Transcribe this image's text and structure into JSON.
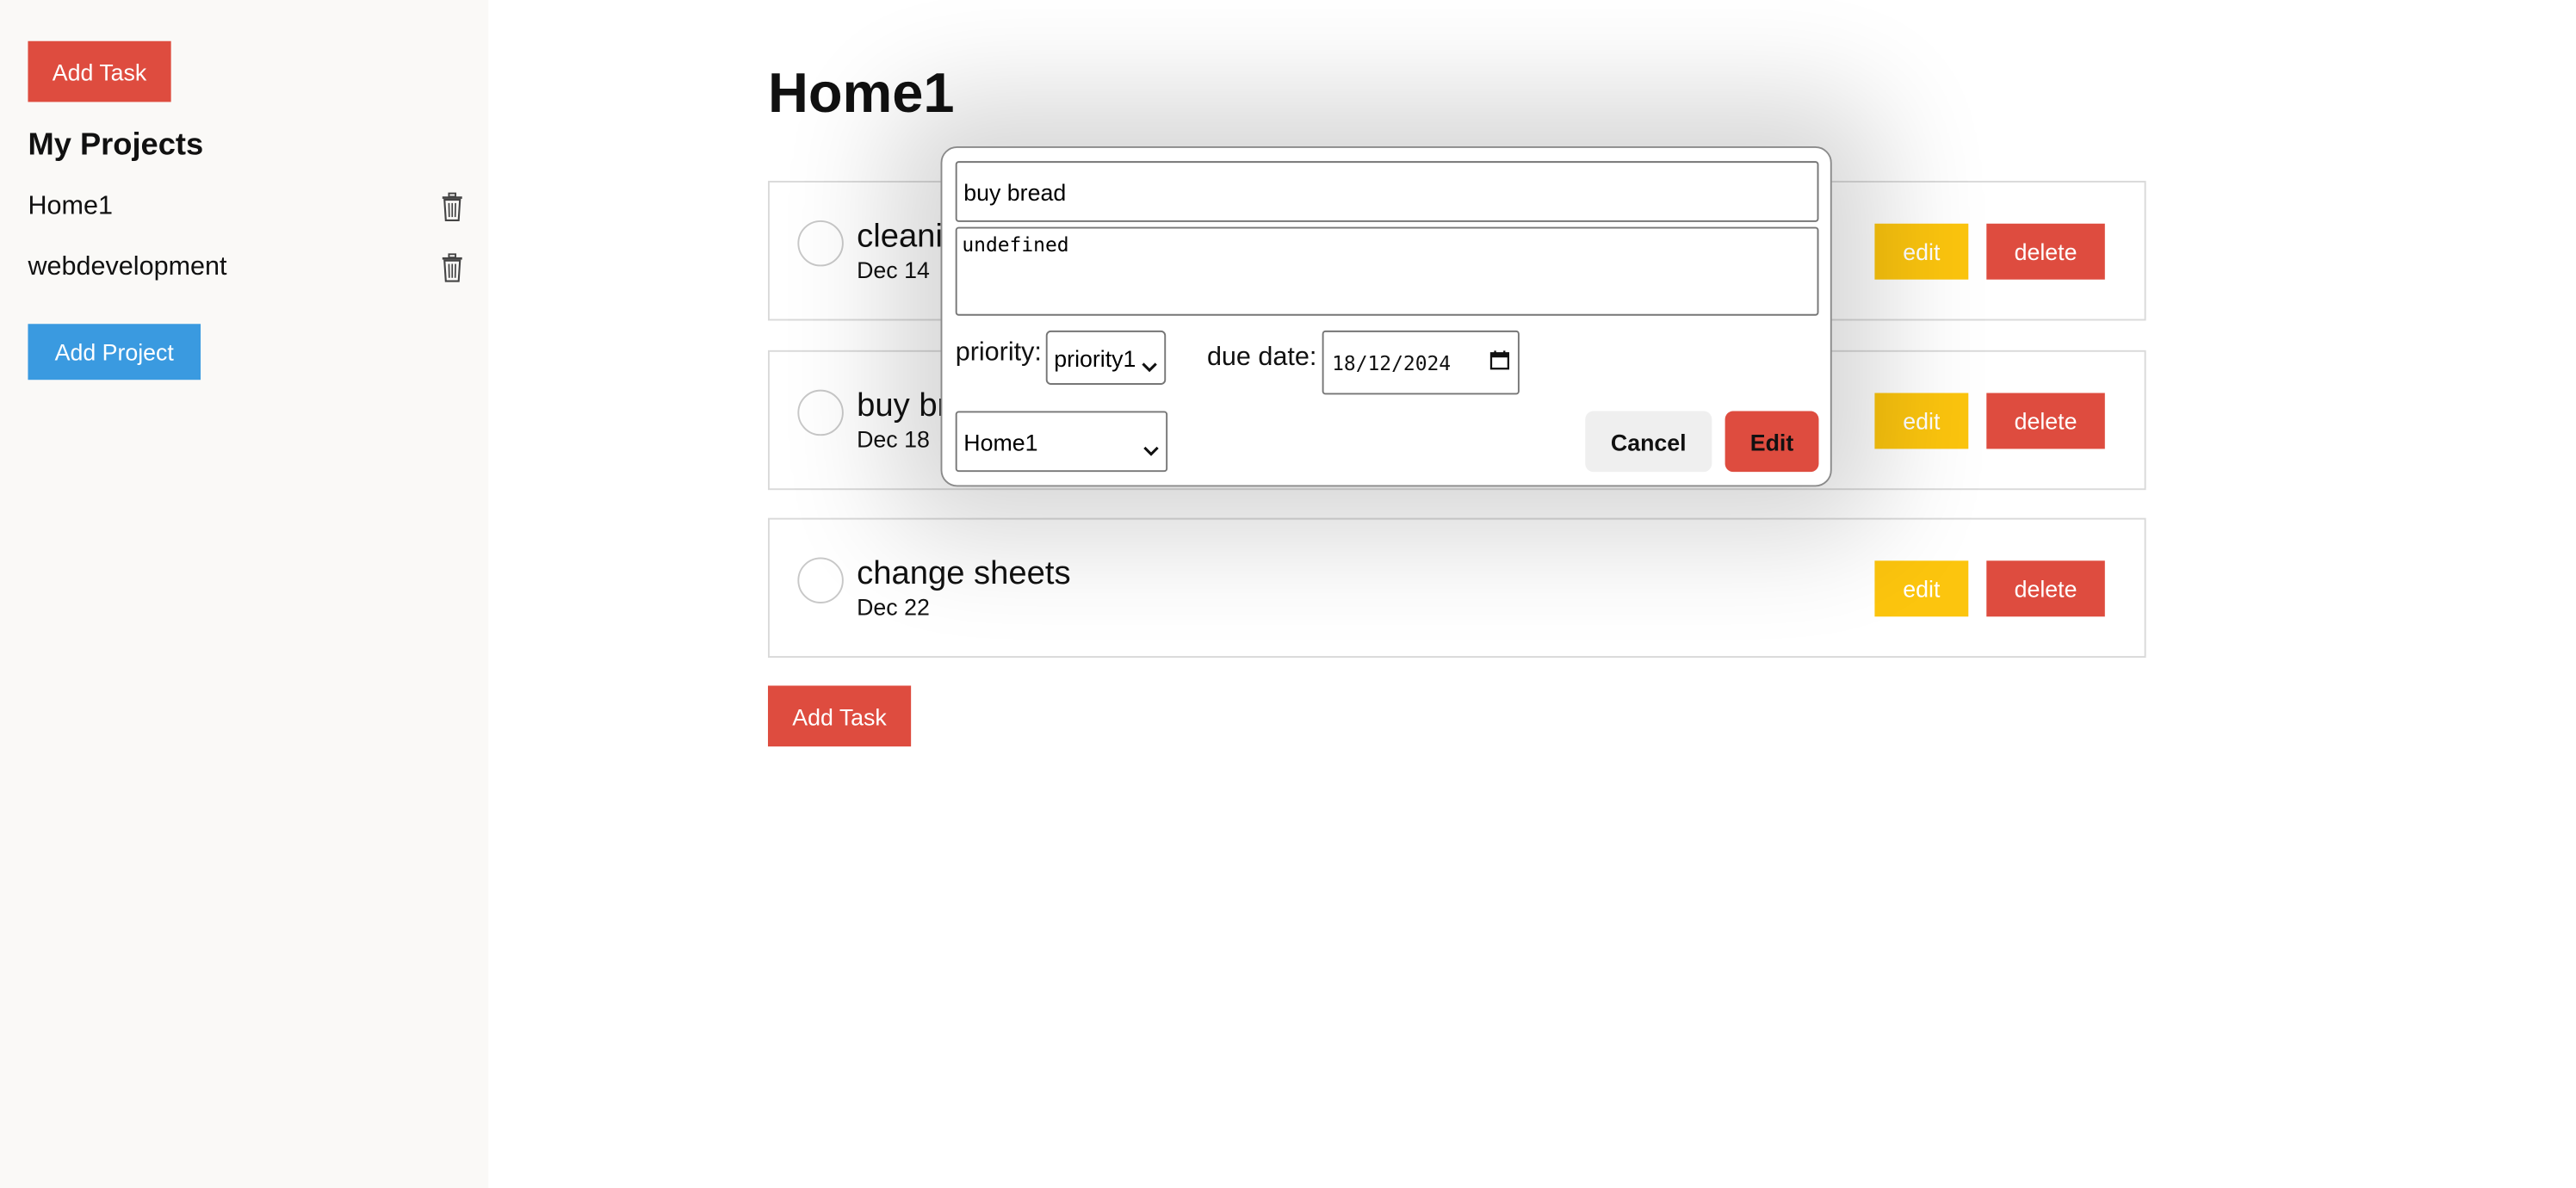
{
  "sidebar": {
    "add_task_label": "Add Task",
    "title": "My Projects",
    "projects": [
      {
        "name": "Home1",
        "icon": "trash-icon"
      },
      {
        "name": "webdevelopment",
        "icon": "trash-icon"
      }
    ],
    "add_project_label": "Add Project"
  },
  "main": {
    "title": "Home1",
    "tasks": [
      {
        "name": "cleaning",
        "date": "Dec 14",
        "edit_label": "edit",
        "delete_label": "delete"
      },
      {
        "name": "buy bread",
        "date": "Dec 18",
        "edit_label": "edit",
        "delete_label": "delete"
      },
      {
        "name": "change sheets",
        "date": "Dec 22",
        "edit_label": "edit",
        "delete_label": "delete"
      }
    ],
    "add_task_label": "Add Task"
  },
  "modal": {
    "title_value": "buy bread",
    "description_value": "undefined",
    "priority_label": "priority:",
    "priority_value": "priority1",
    "due_label": "due date:",
    "due_value": "18/12/2024",
    "project_value": "Home1",
    "cancel_label": "Cancel",
    "edit_label": "Edit"
  },
  "colors": {
    "accent_red": "#de4c3f",
    "accent_blue": "#3a9ae0",
    "accent_yellow": "#fcc50e",
    "sidebar_bg": "#faf9f7"
  }
}
